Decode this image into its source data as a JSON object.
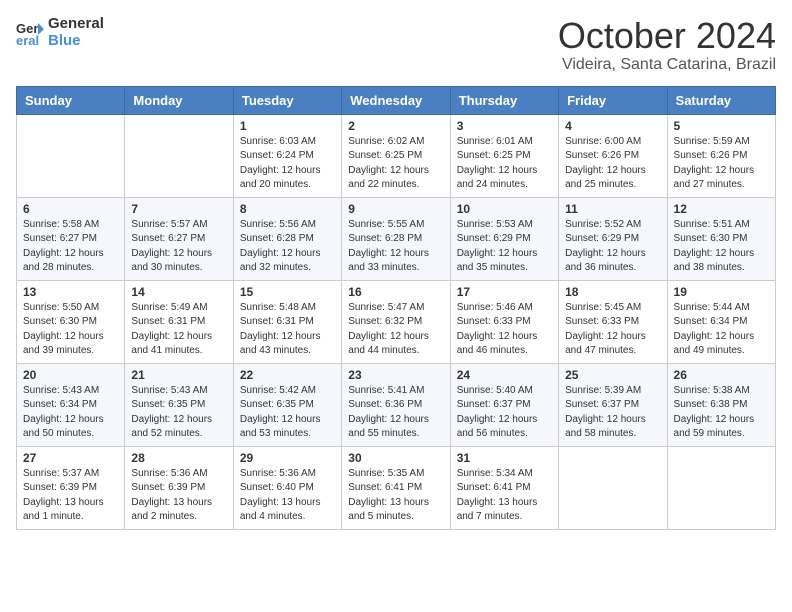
{
  "header": {
    "logo_line1": "General",
    "logo_line2": "Blue",
    "month_year": "October 2024",
    "location": "Videira, Santa Catarina, Brazil"
  },
  "weekdays": [
    "Sunday",
    "Monday",
    "Tuesday",
    "Wednesday",
    "Thursday",
    "Friday",
    "Saturday"
  ],
  "weeks": [
    [
      {
        "day": "",
        "info": ""
      },
      {
        "day": "",
        "info": ""
      },
      {
        "day": "1",
        "info": "Sunrise: 6:03 AM\nSunset: 6:24 PM\nDaylight: 12 hours\nand 20 minutes."
      },
      {
        "day": "2",
        "info": "Sunrise: 6:02 AM\nSunset: 6:25 PM\nDaylight: 12 hours\nand 22 minutes."
      },
      {
        "day": "3",
        "info": "Sunrise: 6:01 AM\nSunset: 6:25 PM\nDaylight: 12 hours\nand 24 minutes."
      },
      {
        "day": "4",
        "info": "Sunrise: 6:00 AM\nSunset: 6:26 PM\nDaylight: 12 hours\nand 25 minutes."
      },
      {
        "day": "5",
        "info": "Sunrise: 5:59 AM\nSunset: 6:26 PM\nDaylight: 12 hours\nand 27 minutes."
      }
    ],
    [
      {
        "day": "6",
        "info": "Sunrise: 5:58 AM\nSunset: 6:27 PM\nDaylight: 12 hours\nand 28 minutes."
      },
      {
        "day": "7",
        "info": "Sunrise: 5:57 AM\nSunset: 6:27 PM\nDaylight: 12 hours\nand 30 minutes."
      },
      {
        "day": "8",
        "info": "Sunrise: 5:56 AM\nSunset: 6:28 PM\nDaylight: 12 hours\nand 32 minutes."
      },
      {
        "day": "9",
        "info": "Sunrise: 5:55 AM\nSunset: 6:28 PM\nDaylight: 12 hours\nand 33 minutes."
      },
      {
        "day": "10",
        "info": "Sunrise: 5:53 AM\nSunset: 6:29 PM\nDaylight: 12 hours\nand 35 minutes."
      },
      {
        "day": "11",
        "info": "Sunrise: 5:52 AM\nSunset: 6:29 PM\nDaylight: 12 hours\nand 36 minutes."
      },
      {
        "day": "12",
        "info": "Sunrise: 5:51 AM\nSunset: 6:30 PM\nDaylight: 12 hours\nand 38 minutes."
      }
    ],
    [
      {
        "day": "13",
        "info": "Sunrise: 5:50 AM\nSunset: 6:30 PM\nDaylight: 12 hours\nand 39 minutes."
      },
      {
        "day": "14",
        "info": "Sunrise: 5:49 AM\nSunset: 6:31 PM\nDaylight: 12 hours\nand 41 minutes."
      },
      {
        "day": "15",
        "info": "Sunrise: 5:48 AM\nSunset: 6:31 PM\nDaylight: 12 hours\nand 43 minutes."
      },
      {
        "day": "16",
        "info": "Sunrise: 5:47 AM\nSunset: 6:32 PM\nDaylight: 12 hours\nand 44 minutes."
      },
      {
        "day": "17",
        "info": "Sunrise: 5:46 AM\nSunset: 6:33 PM\nDaylight: 12 hours\nand 46 minutes."
      },
      {
        "day": "18",
        "info": "Sunrise: 5:45 AM\nSunset: 6:33 PM\nDaylight: 12 hours\nand 47 minutes."
      },
      {
        "day": "19",
        "info": "Sunrise: 5:44 AM\nSunset: 6:34 PM\nDaylight: 12 hours\nand 49 minutes."
      }
    ],
    [
      {
        "day": "20",
        "info": "Sunrise: 5:43 AM\nSunset: 6:34 PM\nDaylight: 12 hours\nand 50 minutes."
      },
      {
        "day": "21",
        "info": "Sunrise: 5:43 AM\nSunset: 6:35 PM\nDaylight: 12 hours\nand 52 minutes."
      },
      {
        "day": "22",
        "info": "Sunrise: 5:42 AM\nSunset: 6:35 PM\nDaylight: 12 hours\nand 53 minutes."
      },
      {
        "day": "23",
        "info": "Sunrise: 5:41 AM\nSunset: 6:36 PM\nDaylight: 12 hours\nand 55 minutes."
      },
      {
        "day": "24",
        "info": "Sunrise: 5:40 AM\nSunset: 6:37 PM\nDaylight: 12 hours\nand 56 minutes."
      },
      {
        "day": "25",
        "info": "Sunrise: 5:39 AM\nSunset: 6:37 PM\nDaylight: 12 hours\nand 58 minutes."
      },
      {
        "day": "26",
        "info": "Sunrise: 5:38 AM\nSunset: 6:38 PM\nDaylight: 12 hours\nand 59 minutes."
      }
    ],
    [
      {
        "day": "27",
        "info": "Sunrise: 5:37 AM\nSunset: 6:39 PM\nDaylight: 13 hours\nand 1 minute."
      },
      {
        "day": "28",
        "info": "Sunrise: 5:36 AM\nSunset: 6:39 PM\nDaylight: 13 hours\nand 2 minutes."
      },
      {
        "day": "29",
        "info": "Sunrise: 5:36 AM\nSunset: 6:40 PM\nDaylight: 13 hours\nand 4 minutes."
      },
      {
        "day": "30",
        "info": "Sunrise: 5:35 AM\nSunset: 6:41 PM\nDaylight: 13 hours\nand 5 minutes."
      },
      {
        "day": "31",
        "info": "Sunrise: 5:34 AM\nSunset: 6:41 PM\nDaylight: 13 hours\nand 7 minutes."
      },
      {
        "day": "",
        "info": ""
      },
      {
        "day": "",
        "info": ""
      }
    ]
  ]
}
